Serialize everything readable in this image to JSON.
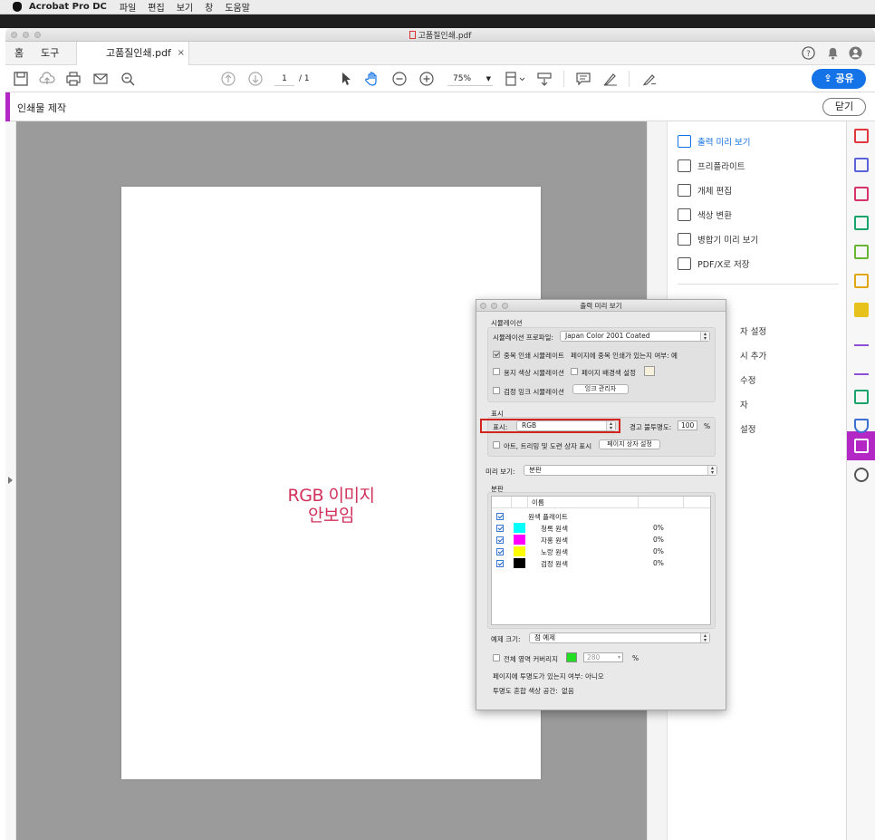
{
  "menubar": {
    "app_name": "Acrobat Pro DC",
    "items": [
      "파일",
      "편집",
      "보기",
      "창",
      "도움말"
    ]
  },
  "window": {
    "title": "고품질인쇄.pdf"
  },
  "tabs": {
    "home": "홈",
    "tools": "도구",
    "doc": "고품질인쇄.pdf",
    "close": "×"
  },
  "toolbar": {
    "page_current": "1",
    "page_total": "/ 1",
    "zoom": "75%",
    "share": "공유"
  },
  "tool_header": {
    "title": "인쇄물 제작",
    "close": "닫기"
  },
  "page": {
    "line1": "RGB 이미지",
    "line2": "안보임"
  },
  "right_panel": {
    "items": [
      {
        "label": "출력 미리 보기",
        "icon": "output-preview-icon",
        "active": true
      },
      {
        "label": "프리플라이트",
        "icon": "preflight-icon"
      },
      {
        "label": "개체 편집",
        "icon": "edit-object-icon"
      },
      {
        "label": "색상 변환",
        "icon": "convert-colors-icon"
      },
      {
        "label": "병합기 미리 보기",
        "icon": "flattener-preview-icon"
      },
      {
        "label": "PDF/X로 저장",
        "icon": "save-pdfx-icon"
      }
    ],
    "hidden_items": [
      "자 설정",
      "시 추가",
      "수정",
      "자",
      "설정"
    ]
  },
  "rail_icons": [
    {
      "name": "create-pdf-icon",
      "color": "#e0383e"
    },
    {
      "name": "combine-files-icon",
      "color": "#5a63d8"
    },
    {
      "name": "organize-pages-icon",
      "color": "#d6336c"
    },
    {
      "name": "export-pdf-icon",
      "color": "#1aa36b"
    },
    {
      "name": "edit-pdf-icon",
      "color": "#68b534"
    },
    {
      "name": "create-form-icon",
      "color": "#e0a712"
    },
    {
      "name": "comment-icon",
      "color": "#e8c21c"
    },
    {
      "name": "fill-sign-icon",
      "color": "#8d4fd8"
    },
    {
      "name": "send-for-signature-icon",
      "color": "#8d4fd8"
    },
    {
      "name": "scan-icon",
      "color": "#1aa36b"
    },
    {
      "name": "protect-icon",
      "color": "#3b6fd4"
    },
    {
      "name": "print-production-icon",
      "color": "#ffffff"
    },
    {
      "name": "more-tools-icon",
      "color": "#555555"
    }
  ],
  "dialog": {
    "title": "출력 미리 보기",
    "sim_group": "시뮬레이션",
    "sim_profile_label": "시뮬레이션 프로파일:",
    "sim_profile_value": "Japan Color 2001 Coated",
    "overprint_label": "중복 인쇄 시뮬레이트",
    "overprint_checked": true,
    "page_overprint_label": "페이지에 중복 인쇄가 있는지 여부:",
    "page_overprint_value": "예",
    "paper_color_label": "용지 색상 시뮬레이션",
    "page_bg_label": "페이지 배경색 설정",
    "black_ink_label": "검정 잉크 시뮬레이션",
    "ink_manager": "잉크 관리자",
    "display_group": "표시",
    "show_label": "표시:",
    "show_value": "RGB",
    "warn_opacity_label": "경고 불투명도:",
    "warn_opacity_value": "100",
    "percent": "%",
    "art_trim_label": "아트, 트리밍 및 도련 상자 표시",
    "page_box_btn": "페이지 상자 설정",
    "preview_label": "미리 보기:",
    "preview_value": "분판",
    "separations_group": "분판",
    "col_name": "이름",
    "separations": [
      {
        "name": "원색 플레이트",
        "color": "",
        "pct": ""
      },
      {
        "name": "청록 원색",
        "color": "#00ffff",
        "pct": "0%"
      },
      {
        "name": "자홍 원색",
        "color": "#ff00ff",
        "pct": "0%"
      },
      {
        "name": "노랑 원색",
        "color": "#ffff00",
        "pct": "0%"
      },
      {
        "name": "검정 원색",
        "color": "#000000",
        "pct": "0%"
      }
    ],
    "sample_size_label": "예제 크기:",
    "sample_size_value": "점 예제",
    "total_coverage_label": "전체 영역 커버리지",
    "coverage_color": "#22dd22",
    "coverage_value": "280",
    "page_transparency_label": "페이지에 투명도가 있는지 여부:",
    "page_transparency_value": "아니오",
    "blend_space_label": "투명도 혼합 색상 공간:",
    "blend_space_value": "없음"
  }
}
